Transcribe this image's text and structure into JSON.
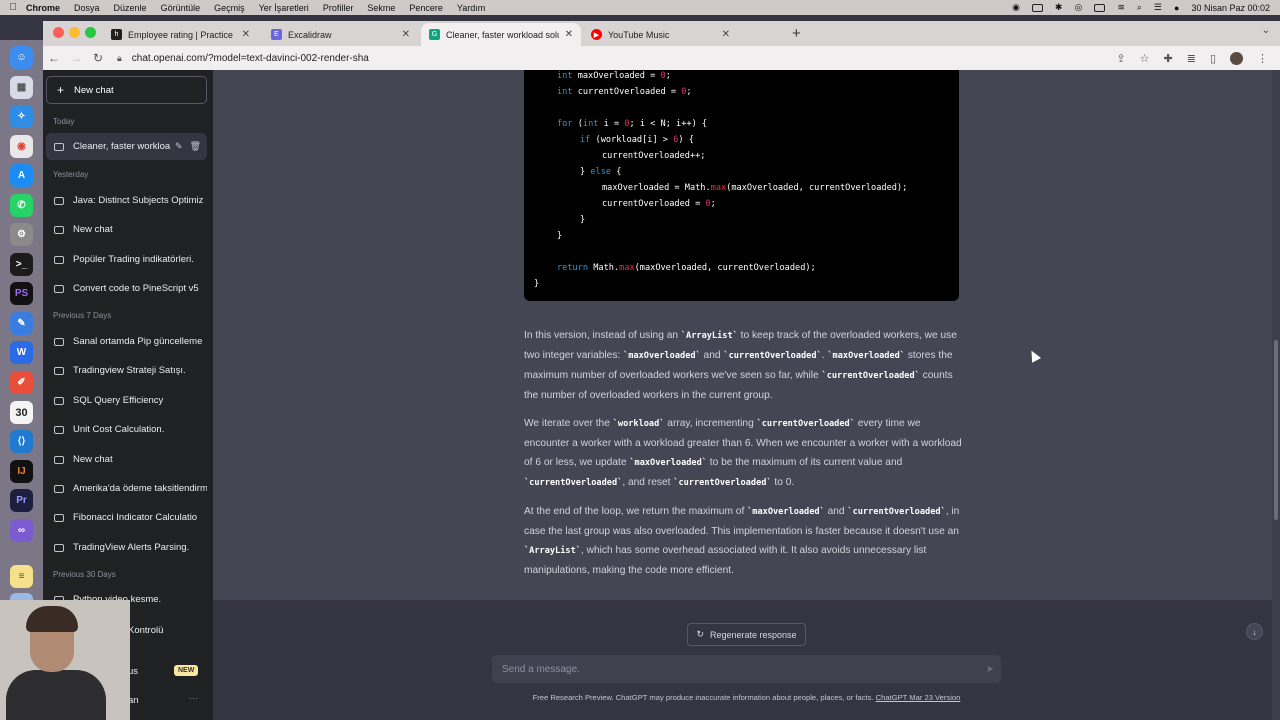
{
  "menubar": {
    "app": "Chrome",
    "items": [
      "Dosya",
      "Düzenle",
      "Görüntüle",
      "Geçmiş",
      "Yer İşaretleri",
      "Profiller",
      "Sekme",
      "Pencere",
      "Yardım"
    ],
    "datetime": "30 Nisan Paz  00:02"
  },
  "tabs": [
    {
      "label": "Employee rating | Practice Prob",
      "favicon": "h",
      "color": "#1f1f1f"
    },
    {
      "label": "Excalidraw",
      "favicon": "E",
      "color": "#6965db"
    },
    {
      "label": "Cleaner, faster workload soluti",
      "favicon": "G",
      "color": "#10a37f"
    },
    {
      "label": "YouTube Music",
      "favicon": "▶",
      "color": "#ff0000"
    }
  ],
  "address": {
    "url": "chat.openai.com/?model=text-davinci-002-render-sha"
  },
  "sidebar": {
    "new_chat": "New chat",
    "sections": {
      "today": "Today",
      "yesterday": "Yesterday",
      "prev7": "Previous 7 Days",
      "prev30": "Previous 30 Days"
    },
    "today_items": [
      "Cleaner, faster workloa"
    ],
    "yesterday_items": [
      "Java: Distinct Subjects Optimiz",
      "New chat",
      "Popüler Trading indikatörleri.",
      "Convert code to PineScript v5"
    ],
    "prev7_items": [
      "Sanal ortamda Pip güncelleme",
      "Tradingview Strateji Satışı.",
      "SQL Query Efficiency",
      "Unit Cost Calculation.",
      "New chat",
      "Amerika'da ödeme taksitlendirme",
      "Fibonacci Indicator Calculatio",
      "TradingView Alerts Parsing."
    ],
    "prev30_items": [
      "Python video kesme.",
      "Kontrolü"
    ],
    "upgrade_tail": "us",
    "new_badge": "NEW",
    "user_tail": "an",
    "more": "···"
  },
  "code": {
    "l1_type": "int",
    "l1_rest": " maxOverloaded = ",
    "l1_val": "0",
    "l1_end": ";",
    "l2_type": "int",
    "l2_rest": " currentOverloaded = ",
    "l2_val": "0",
    "l2_end": ";",
    "l3_for": "for",
    "l3_a": " (",
    "l3_int": "int",
    "l3_b": " i = ",
    "l3_zero": "0",
    "l3_c": "; i < N; i++) {",
    "l4_if": "if",
    "l4_a": " (workload[i] > ",
    "l4_six": "6",
    "l4_b": ") {",
    "l5": "currentOverloaded++;",
    "l6_a": "} ",
    "l6_else": "else",
    "l6_b": " {",
    "l7_a": "maxOverloaded = Math.",
    "l7_max": "max",
    "l7_b": "(maxOverloaded, currentOverloaded);",
    "l8_a": "currentOverloaded = ",
    "l8_zero": "0",
    "l8_b": ";",
    "l9": "}",
    "l10": "}",
    "l11_return": "return",
    "l11_a": " Math.",
    "l11_max": "max",
    "l11_b": "(maxOverloaded, currentOverloaded);",
    "l12": "}"
  },
  "response": {
    "p1": [
      "In this version, instead of using an ",
      "`ArrayList`",
      " to keep track of the overloaded workers, we use two integer variables: ",
      "`maxOverloaded`",
      " and ",
      "`currentOverloaded`",
      ". ",
      "`maxOverloaded`",
      " stores the maximum number of overloaded workers we've seen so far, while ",
      "`currentOverloaded`",
      " counts the number of overloaded workers in the current group."
    ],
    "p2": [
      "We iterate over the ",
      "`workload`",
      " array, incrementing ",
      "`currentOverloaded`",
      " every time we encounter a worker with a workload greater than 6. When we encounter a worker with a workload of 6 or less, we update ",
      "`maxOverloaded`",
      " to be the maximum of its current value and ",
      "`currentOverloaded`",
      ", and reset ",
      "`currentOverloaded`",
      " to 0."
    ],
    "p3": [
      "At the end of the loop, we return the maximum of ",
      "`maxOverloaded`",
      " and ",
      "`currentOverloaded`",
      ", in case the last group was also overloaded. This implementation is faster because it doesn't use an ",
      "`ArrayList`",
      ", which has some overhead associated with it. It also avoids unnecessary list manipulations, making the code more efficient."
    ]
  },
  "composer": {
    "regenerate": "Regenerate response",
    "placeholder": "Send a message.",
    "footer_text": "Free Research Preview. ChatGPT may produce inaccurate information about people, places, or facts. ",
    "footer_link": "ChatGPT Mar 23 Version"
  },
  "dock": {
    "calendar_day": "30",
    "labels": [
      "PS",
      "Pr",
      "IJ"
    ]
  },
  "colors": {
    "sidebar_bg": "#202123",
    "main_bg": "#444654",
    "composer_bg": "#343541",
    "keyword": "#2e95d3",
    "number": "#df3079"
  }
}
